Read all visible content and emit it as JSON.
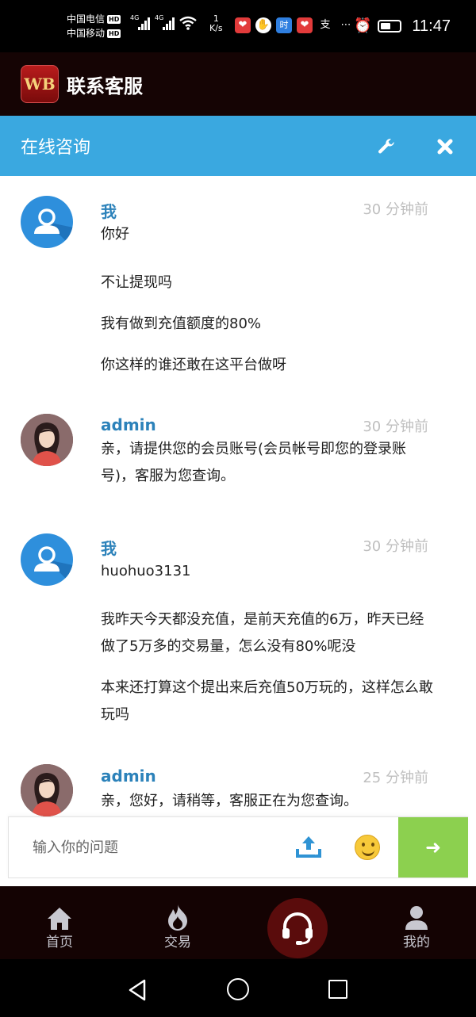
{
  "status_bar": {
    "carrier_1": "中国电信",
    "carrier_2": "中国移动",
    "hd_badge": "HD",
    "network_1": "4G",
    "network_2": "4G",
    "speed_value": "1",
    "speed_unit": "K/s",
    "time": "11:47"
  },
  "app_header": {
    "logo_text": "WB",
    "title": "联系客服"
  },
  "chat_header": {
    "title": "在线咨询"
  },
  "messages": [
    {
      "sender": "我",
      "time": "30 分钟前",
      "avatar": "user-avatar",
      "lines": [
        "你好",
        "不让提现吗",
        "我有做到充值额度的80%",
        "你这样的谁还敢在这平台做呀"
      ]
    },
    {
      "sender": "admin",
      "time": "30 分钟前",
      "avatar": "admin-avatar",
      "lines": [
        "亲，请提供您的会员账号(会员帐号即您的登录账号)，客服为您查询。"
      ]
    },
    {
      "sender": "我",
      "time": "30 分钟前",
      "avatar": "user-avatar",
      "lines": [
        "huohuo3131",
        "我昨天今天都没充值，是前天充值的6万，昨天已经做了5万多的交易量，怎么没有80%呢没",
        "本来还打算这个提出来后充值50万玩的，这样怎么敢玩吗"
      ]
    },
    {
      "sender": "admin",
      "time": "25 分钟前",
      "avatar": "admin-avatar",
      "lines": [
        "亲，您好，请稍等，客服正在为您查询。"
      ]
    }
  ],
  "input": {
    "placeholder": "输入你的问题",
    "upload_icon": "upload-icon",
    "emoji_icon": "emoji-icon",
    "send_icon": "arrow-right-icon",
    "send_arrow": "➜"
  },
  "bottom_nav": {
    "items": [
      {
        "label": "首页",
        "icon": "home-icon"
      },
      {
        "label": "交易",
        "icon": "flame-icon"
      },
      {
        "label": "",
        "icon": "headset-icon"
      },
      {
        "label": "我的",
        "icon": "person-icon"
      }
    ]
  },
  "colors": {
    "chat_header_bg": "#3aa8e0",
    "sender_name": "#2c82ba",
    "send_button": "#8cd04f",
    "nav_bg": "#140303"
  }
}
